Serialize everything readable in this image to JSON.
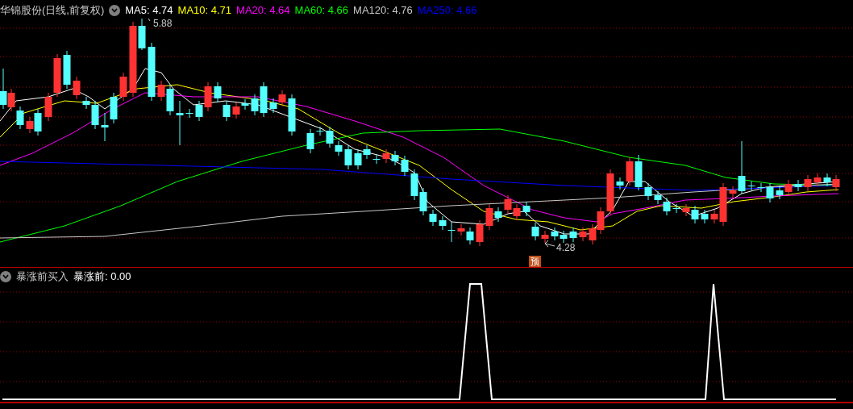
{
  "header": {
    "stock": "华锦股份(日线,前复权)",
    "ma": [
      {
        "label": "MA5: 4.74",
        "color": "#ffffff"
      },
      {
        "label": "MA10: 4.71",
        "color": "#ffff00"
      },
      {
        "label": "MA20: 4.64",
        "color": "#ff00ff"
      },
      {
        "label": "MA60: 4.66",
        "color": "#00ff00"
      },
      {
        "label": "MA120: 4.76",
        "color": "#c8c8c8"
      },
      {
        "label": "MA250: 4.66",
        "color": "#0000ff"
      }
    ]
  },
  "price_marks": [
    {
      "text": "5.88"
    },
    {
      "text": "4.28"
    }
  ],
  "forecast_badge": "预",
  "indicator": {
    "name": "暴涨前买入",
    "reading": "暴涨前: 0.00"
  }
}
